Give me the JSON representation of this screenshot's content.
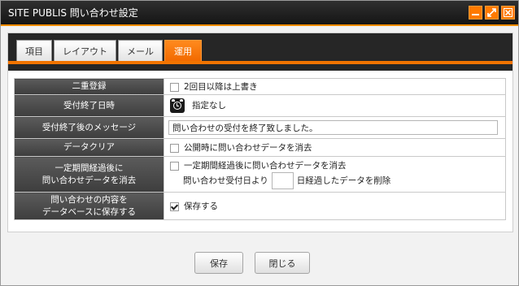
{
  "window": {
    "title": "SITE PUBLIS 問い合わせ設定",
    "buttons": [
      "minimize-icon",
      "maximize-icon",
      "close-icon"
    ]
  },
  "tabs": [
    {
      "label": "項目",
      "active": false
    },
    {
      "label": "レイアウト",
      "active": false
    },
    {
      "label": "メール",
      "active": false
    },
    {
      "label": "運用",
      "active": true
    }
  ],
  "colors": {
    "accent": "#f27400",
    "titlebar": "#1f1f1f",
    "label_bg": "#4a4a4a"
  },
  "rows": {
    "double_registration": {
      "label": "二重登録",
      "checkbox_label": "2回目以降は上書き",
      "checked": false
    },
    "end_datetime": {
      "label": "受付終了日時",
      "icon": "alarm-clock-icon",
      "value": "指定なし"
    },
    "end_message": {
      "label": "受付終了後のメッセージ",
      "value": "問い合わせの受付を終了致しました。"
    },
    "data_clear": {
      "label": "データクリア",
      "checkbox_label": "公開時に問い合わせデータを消去",
      "checked": false
    },
    "period_delete": {
      "label_line1": "一定期間経過後に",
      "label_line2": "問い合わせデータを消去",
      "checkbox_label": "一定期間経過後に問い合わせデータを消去",
      "checked": false,
      "prefix": "問い合わせ受付日より",
      "days_value": "",
      "suffix": "日経過したデータを削除"
    },
    "save_db": {
      "label_line1": "問い合わせの内容を",
      "label_line2": "データベースに保存する",
      "checkbox_label": "保存する",
      "checked": true
    }
  },
  "footer": {
    "save_label": "保存",
    "close_label": "閉じる"
  }
}
